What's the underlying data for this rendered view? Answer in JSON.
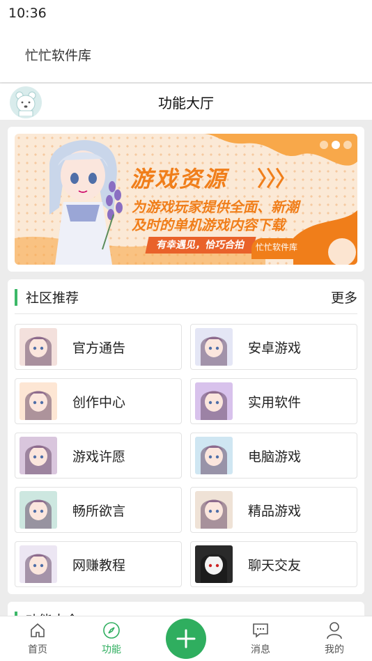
{
  "status_bar": {
    "time": "10:36"
  },
  "app_header": {
    "title": "忙忙软件库"
  },
  "page_header": {
    "title": "功能大厅"
  },
  "banner": {
    "title": "游戏资源",
    "arrows": "〉〉〉",
    "subtitle_line1": "为游戏玩家提供全面、新潮",
    "subtitle_line2": "及时的单机游戏内容下载",
    "slogan": "有幸遇见，恰巧合拍",
    "brand": "忙忙软件库",
    "active_dot_index": 1
  },
  "community": {
    "title": "社区推荐",
    "more_label": "更多",
    "items": [
      {
        "label": "官方通告",
        "thumb": "anime-girl-avatar",
        "color": "#f3e0dc"
      },
      {
        "label": "安卓游戏",
        "thumb": "anime-girl-avatar",
        "color": "#e4e6f5"
      },
      {
        "label": "创作中心",
        "thumb": "anime-girl-avatar",
        "color": "#fde6d4"
      },
      {
        "label": "实用软件",
        "thumb": "anime-girl-avatar",
        "color": "#d8c2ec"
      },
      {
        "label": "游戏许愿",
        "thumb": "anime-girl-avatar",
        "color": "#d9c6dd"
      },
      {
        "label": "电脑游戏",
        "thumb": "anime-girl-avatar",
        "color": "#cfe6f2"
      },
      {
        "label": "畅所欲言",
        "thumb": "anime-girl-avatar",
        "color": "#cde7e0"
      },
      {
        "label": "精品游戏",
        "thumb": "anime-girl-avatar",
        "color": "#efe2d6"
      },
      {
        "label": "网赚教程",
        "thumb": "anime-girl-avatar",
        "color": "#ece6f3"
      },
      {
        "label": "聊天交友",
        "thumb": "anime-girl-avatar",
        "color": "#2a2a2a"
      }
    ]
  },
  "next_section": {
    "title": "功能大全"
  },
  "tab_bar": {
    "tabs": [
      {
        "label": "首页",
        "icon": "home-icon"
      },
      {
        "label": "功能",
        "icon": "compass-icon"
      },
      {
        "label": "消息",
        "icon": "message-icon"
      },
      {
        "label": "我的",
        "icon": "user-icon"
      }
    ],
    "active": "功能",
    "accent": "#2fae5f"
  }
}
